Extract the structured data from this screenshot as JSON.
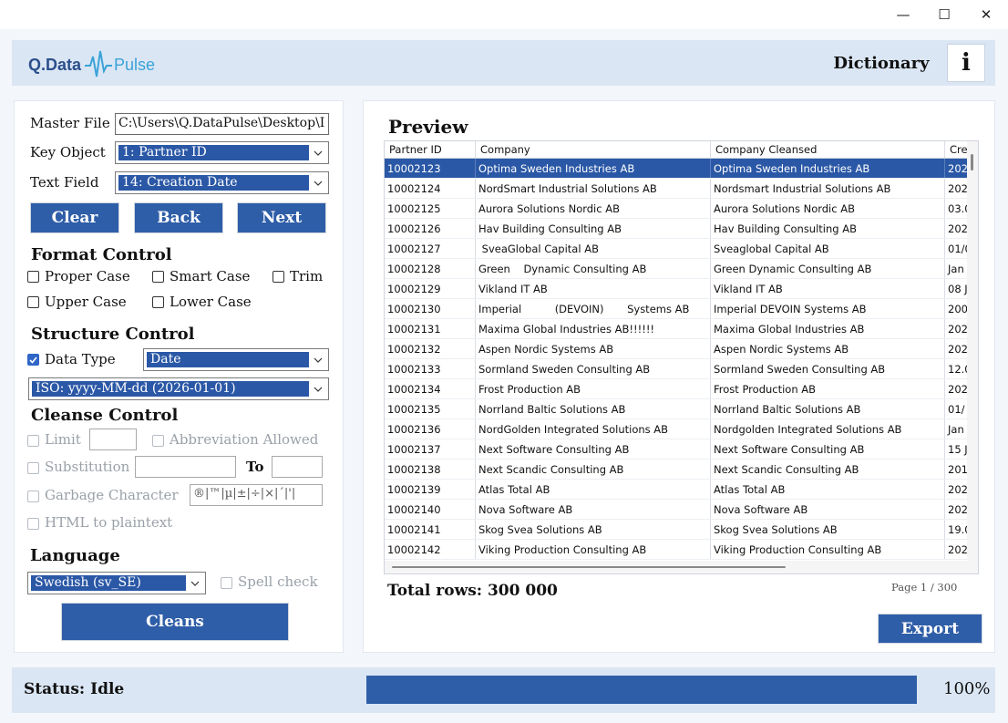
{
  "window": {
    "minimize": "—",
    "maximize": "☐",
    "close": "✕"
  },
  "header": {
    "logo_left": "Q.Data",
    "logo_right": "Pulse",
    "dictionary_label": "Dictionary",
    "info_label": "i"
  },
  "master": {
    "master_file_label": "Master File",
    "master_file_value": "C:\\Users\\Q.DataPulse\\Desktop\\I",
    "key_object_label": "Key Object",
    "key_object_value": "1: Partner ID",
    "text_field_label": "Text Field",
    "text_field_value": "14: Creation Date",
    "clear_label": "Clear",
    "back_label": "Back",
    "next_label": "Next"
  },
  "format_control": {
    "title": "Format Control",
    "proper_case": "Proper Case",
    "smart_case": "Smart Case",
    "trim": "Trim",
    "upper_case": "Upper Case",
    "lower_case": "Lower Case"
  },
  "structure_control": {
    "title": "Structure Control",
    "data_type_label": "Data Type",
    "data_type_value": "Date",
    "format_value": "ISO: yyyy-MM-dd   (2026-01-01)"
  },
  "cleanse_control": {
    "title": "Cleanse Control",
    "limit": "Limit",
    "limit_value": "",
    "abbreviation": "Abbreviation Allowed",
    "substitution": "Substitution",
    "substitution_value": "",
    "to_label": "To",
    "to_value": "",
    "garbage": "Garbage Character",
    "garbage_value": "®|™|µ|±|÷|×|´|'|",
    "html": "HTML to plaintext"
  },
  "language": {
    "title": "Language",
    "value": "Swedish (sv_SE)",
    "spell_check": "Spell check",
    "cleans_label": "Cleans"
  },
  "preview": {
    "title": "Preview",
    "columns": [
      "Partner ID",
      "Company",
      "Company Cleansed",
      "Cre"
    ],
    "rows": [
      [
        "10002123",
        "Optima Sweden Industries AB",
        "Optima Sweden Industries AB",
        "202"
      ],
      [
        "10002124",
        "NordSmart Industrial Solutions AB",
        "Nordsmart Industrial Solutions AB",
        "202"
      ],
      [
        "10002125",
        "Aurora Solutions Nordic AB",
        "Aurora Solutions Nordic AB",
        "03.0"
      ],
      [
        "10002126",
        "Hav Building Consulting AB",
        "Hav Building Consulting AB",
        "202"
      ],
      [
        "10002127",
        " SveaGlobal Capital AB",
        "Sveaglobal Capital AB",
        "01/0"
      ],
      [
        "10002128",
        "Green    Dynamic Consulting AB",
        "Green Dynamic Consulting AB",
        "Jan"
      ],
      [
        "10002129",
        "Vikland IT AB",
        "Vikland IT AB",
        "08 J"
      ],
      [
        "10002130",
        "Imperial          (DEVOIN)       Systems AB",
        "Imperial DEVOIN Systems AB",
        "200"
      ],
      [
        "10002131",
        "Maxima Global Industries AB!!!!!!",
        "Maxima Global Industries AB",
        "202"
      ],
      [
        "10002132",
        "Aspen Nordic Systems AB",
        "Aspen Nordic Systems AB",
        "202"
      ],
      [
        "10002133",
        "Sormland Sweden Consulting AB",
        "Sormland Sweden Consulting AB",
        "12.0"
      ],
      [
        "10002134",
        "Frost Production AB",
        "Frost Production AB",
        "202"
      ],
      [
        "10002135",
        "Norrland Baltic Solutions AB",
        "Norrland Baltic Solutions AB",
        "01/"
      ],
      [
        "10002136",
        "NordGolden Integrated Solutions AB",
        "Nordgolden Integrated Solutions AB",
        "Jan"
      ],
      [
        "10002137",
        "Next Software Consulting AB",
        "Next Software Consulting AB",
        "15 J"
      ],
      [
        "10002138",
        "Next Scandic Consulting AB",
        "Next Scandic Consulting AB",
        "201"
      ],
      [
        "10002139",
        "Atlas Total AB",
        "Atlas Total AB",
        "202"
      ],
      [
        "10002140",
        "Nova Software AB",
        "Nova Software AB",
        "202"
      ],
      [
        "10002141",
        "Skog Svea Solutions AB",
        "Skog Svea Solutions AB",
        "19.0"
      ],
      [
        "10002142",
        "Viking Production Consulting AB",
        "Viking Production Consulting AB",
        "202"
      ]
    ],
    "total_rows": "Total rows: 300 000",
    "page": "Page 1 / 300",
    "export_label": "Export"
  },
  "status": {
    "text": "Status: Idle",
    "progress_fraction": 1.0,
    "percent": "100%"
  },
  "colors": {
    "accent": "#2f5ea8",
    "selection": "#2b58a6",
    "header_bg": "#dbe6f4",
    "logo_dark": "#2b4f8c",
    "logo_light": "#3aa3d8"
  }
}
